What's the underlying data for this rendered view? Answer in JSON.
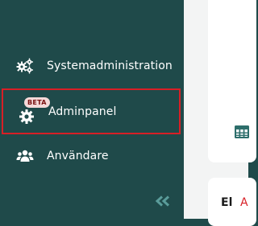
{
  "sidebar": {
    "items": [
      {
        "label": "Systemadministration",
        "icon": "gears-icon"
      },
      {
        "label": "Adminpanel",
        "icon": "gear-icon",
        "badge": "BETA"
      },
      {
        "label": "Användare",
        "icon": "users-icon"
      }
    ],
    "collapse_icon": "double-chevron-left-icon"
  },
  "main": {
    "card_icon": "table-icon",
    "bottom_text_1": "El",
    "bottom_text_2": "A"
  },
  "colors": {
    "sidebar_bg": "#1f4a4a",
    "highlight_border": "#d81f26",
    "accent_teal": "#2d6e6b",
    "badge_bg": "#f6dada",
    "main_bg": "#f3f4f4"
  }
}
